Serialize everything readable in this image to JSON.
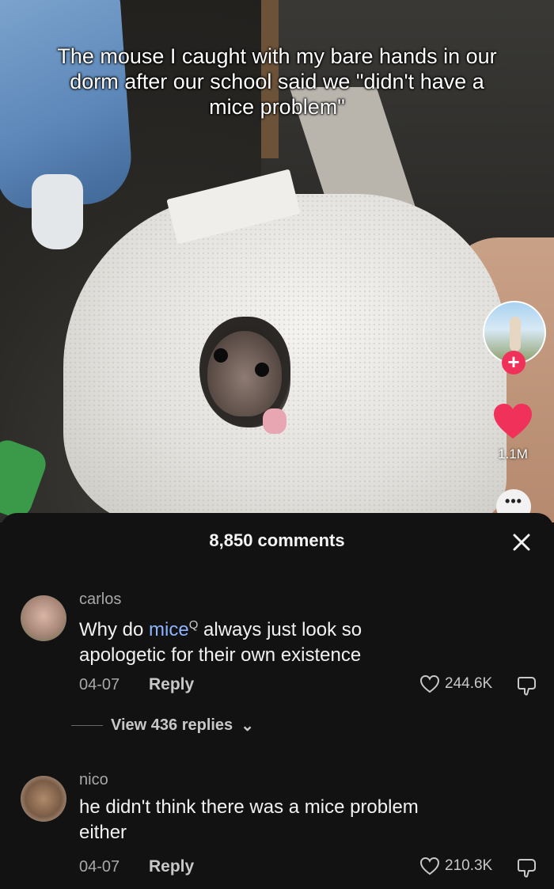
{
  "video": {
    "caption": "The mouse I caught with my bare hands in our dorm after our school said we \"didn't have a mice problem\"",
    "like_count": "1.1M",
    "more_label": "•••",
    "follow_label": "+"
  },
  "comments_panel": {
    "title": "8,850 comments",
    "close_label": "×",
    "comments": [
      {
        "user": "carlos",
        "text_before": "Why do ",
        "text_highlight": "mice",
        "search_glyph": "Q",
        "text_after": " always just look so apologetic for their own existence",
        "date": "04-07",
        "reply_label": "Reply",
        "likes": "244.6K",
        "view_replies_label": "View 436 replies",
        "view_replies_chevron": "⌄"
      },
      {
        "user": "nico",
        "text": "he didn't think there was a mice problem either",
        "date": "04-07",
        "reply_label": "Reply",
        "likes": "210.3K"
      }
    ]
  },
  "colors": {
    "panel_bg": "#121212",
    "like_heart": "#f0325a",
    "highlight_link": "#8fb4ff"
  },
  "icons": [
    "heart-icon",
    "close-icon",
    "heart-outline-icon",
    "dislike-icon",
    "plus-icon",
    "more-icon",
    "chevron-down-icon",
    "search-icon"
  ]
}
